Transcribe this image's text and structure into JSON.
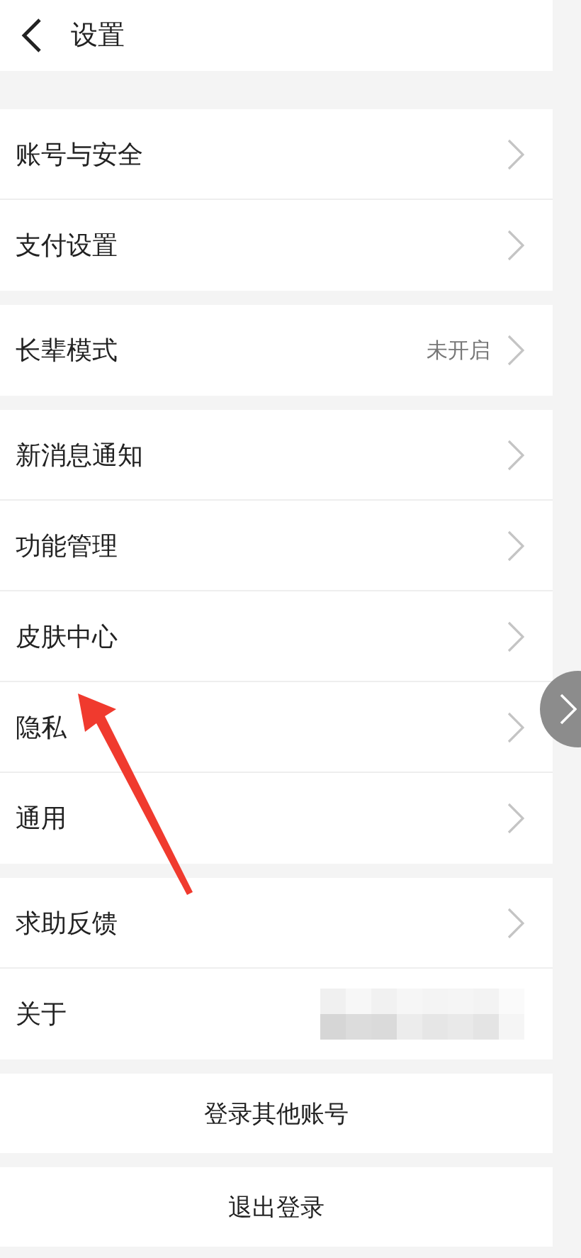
{
  "header": {
    "title": "设置"
  },
  "groups": [
    {
      "rows": [
        {
          "label": "账号与安全",
          "kind": "link"
        },
        {
          "label": "支付设置",
          "kind": "link"
        }
      ]
    },
    {
      "rows": [
        {
          "label": "长辈模式",
          "kind": "link",
          "value": "未开启"
        }
      ]
    },
    {
      "rows": [
        {
          "label": "新消息通知",
          "kind": "link"
        },
        {
          "label": "功能管理",
          "kind": "link"
        },
        {
          "label": "皮肤中心",
          "kind": "link"
        },
        {
          "label": "隐私",
          "kind": "link"
        },
        {
          "label": "通用",
          "kind": "link"
        }
      ]
    },
    {
      "rows": [
        {
          "label": "求助反馈",
          "kind": "link"
        },
        {
          "label": "关于",
          "kind": "redacted"
        }
      ]
    }
  ],
  "buttons": [
    {
      "label": "登录其他账号"
    },
    {
      "label": "退出登录"
    }
  ]
}
